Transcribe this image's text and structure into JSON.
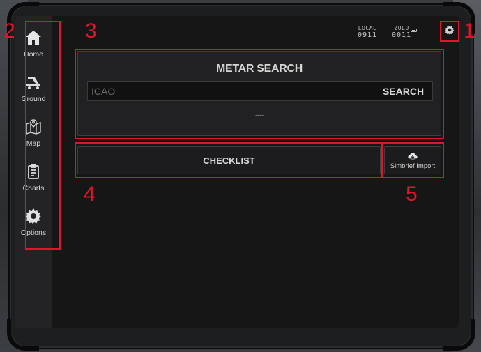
{
  "sidebar": {
    "items": [
      {
        "label": "Home"
      },
      {
        "label": "Ground"
      },
      {
        "label": "Map"
      },
      {
        "label": "Charts"
      },
      {
        "label": "Options"
      }
    ]
  },
  "topbar": {
    "local_label": "LOCAL",
    "local_time": "0911",
    "zulu_label": "ZULU",
    "zulu_time": "0011"
  },
  "metar": {
    "title": "METAR SEARCH",
    "input_placeholder": "ICAO",
    "input_value": "",
    "search_label": "SEARCH",
    "result_text": "----"
  },
  "checklist_label": "CHECKLIST",
  "simbrief_label": "Simbrief Import",
  "annotations": [
    "1",
    "2",
    "3",
    "4",
    "5"
  ],
  "colors": {
    "annotation": "#e0142a",
    "screen_bg": "#161617",
    "sidebar_bg": "#232325",
    "text": "#d8d8d8"
  }
}
